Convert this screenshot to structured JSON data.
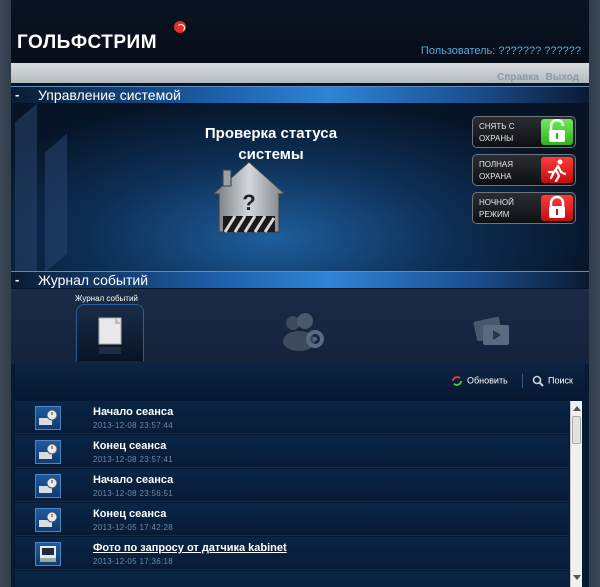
{
  "header": {
    "logo_text": "ГОЛЬФСТРИМ",
    "user_text": "Пользователь: ??????? ??????",
    "links": {
      "help": "Справка",
      "logout": "Выход"
    }
  },
  "system_section": {
    "title": "Управление системой",
    "dash": "-",
    "status_title_line1": "Проверка статуса",
    "status_title_line2": "системы",
    "buttons": [
      {
        "label": "СНЯТЬ С ОХРАНЫ",
        "icon": "unlock-icon",
        "color": "#2eb31e"
      },
      {
        "label": "ПОЛНАЯ ОХРАНА",
        "icon": "running-man-icon",
        "color": "#d41515"
      },
      {
        "label": "НОЧНОЙ РЕЖИМ",
        "icon": "lock-icon",
        "color": "#d41515"
      }
    ]
  },
  "journal_section": {
    "title": "Журнал событий",
    "dash": "-",
    "tabs": [
      {
        "label": "Журнал событий",
        "icon": "document-icon",
        "active": true
      },
      {
        "label": "",
        "icon": "users-settings-icon",
        "active": false
      },
      {
        "label": "",
        "icon": "media-icon",
        "active": false
      }
    ]
  },
  "toolbar": {
    "refresh_label": "Обновить",
    "search_label": "Поиск"
  },
  "events": [
    {
      "title": "Начало сеанса",
      "time": "2013-12-08 23:57:44",
      "icon": "session-icon",
      "link": false
    },
    {
      "title": "Конец сеанса",
      "time": "2013-12-08 23:57:41",
      "icon": "session-icon",
      "link": false
    },
    {
      "title": "Начало сеанса",
      "time": "2013-12-08 23:56:51",
      "icon": "session-icon",
      "link": false
    },
    {
      "title": "Конец сеанса",
      "time": "2013-12-05 17:42:28",
      "icon": "session-icon",
      "link": false
    },
    {
      "title": "Фото по запросу от датчика kabinet",
      "time": "2013-12-05 17:36:18",
      "icon": "photo-icon",
      "link": true
    }
  ]
}
